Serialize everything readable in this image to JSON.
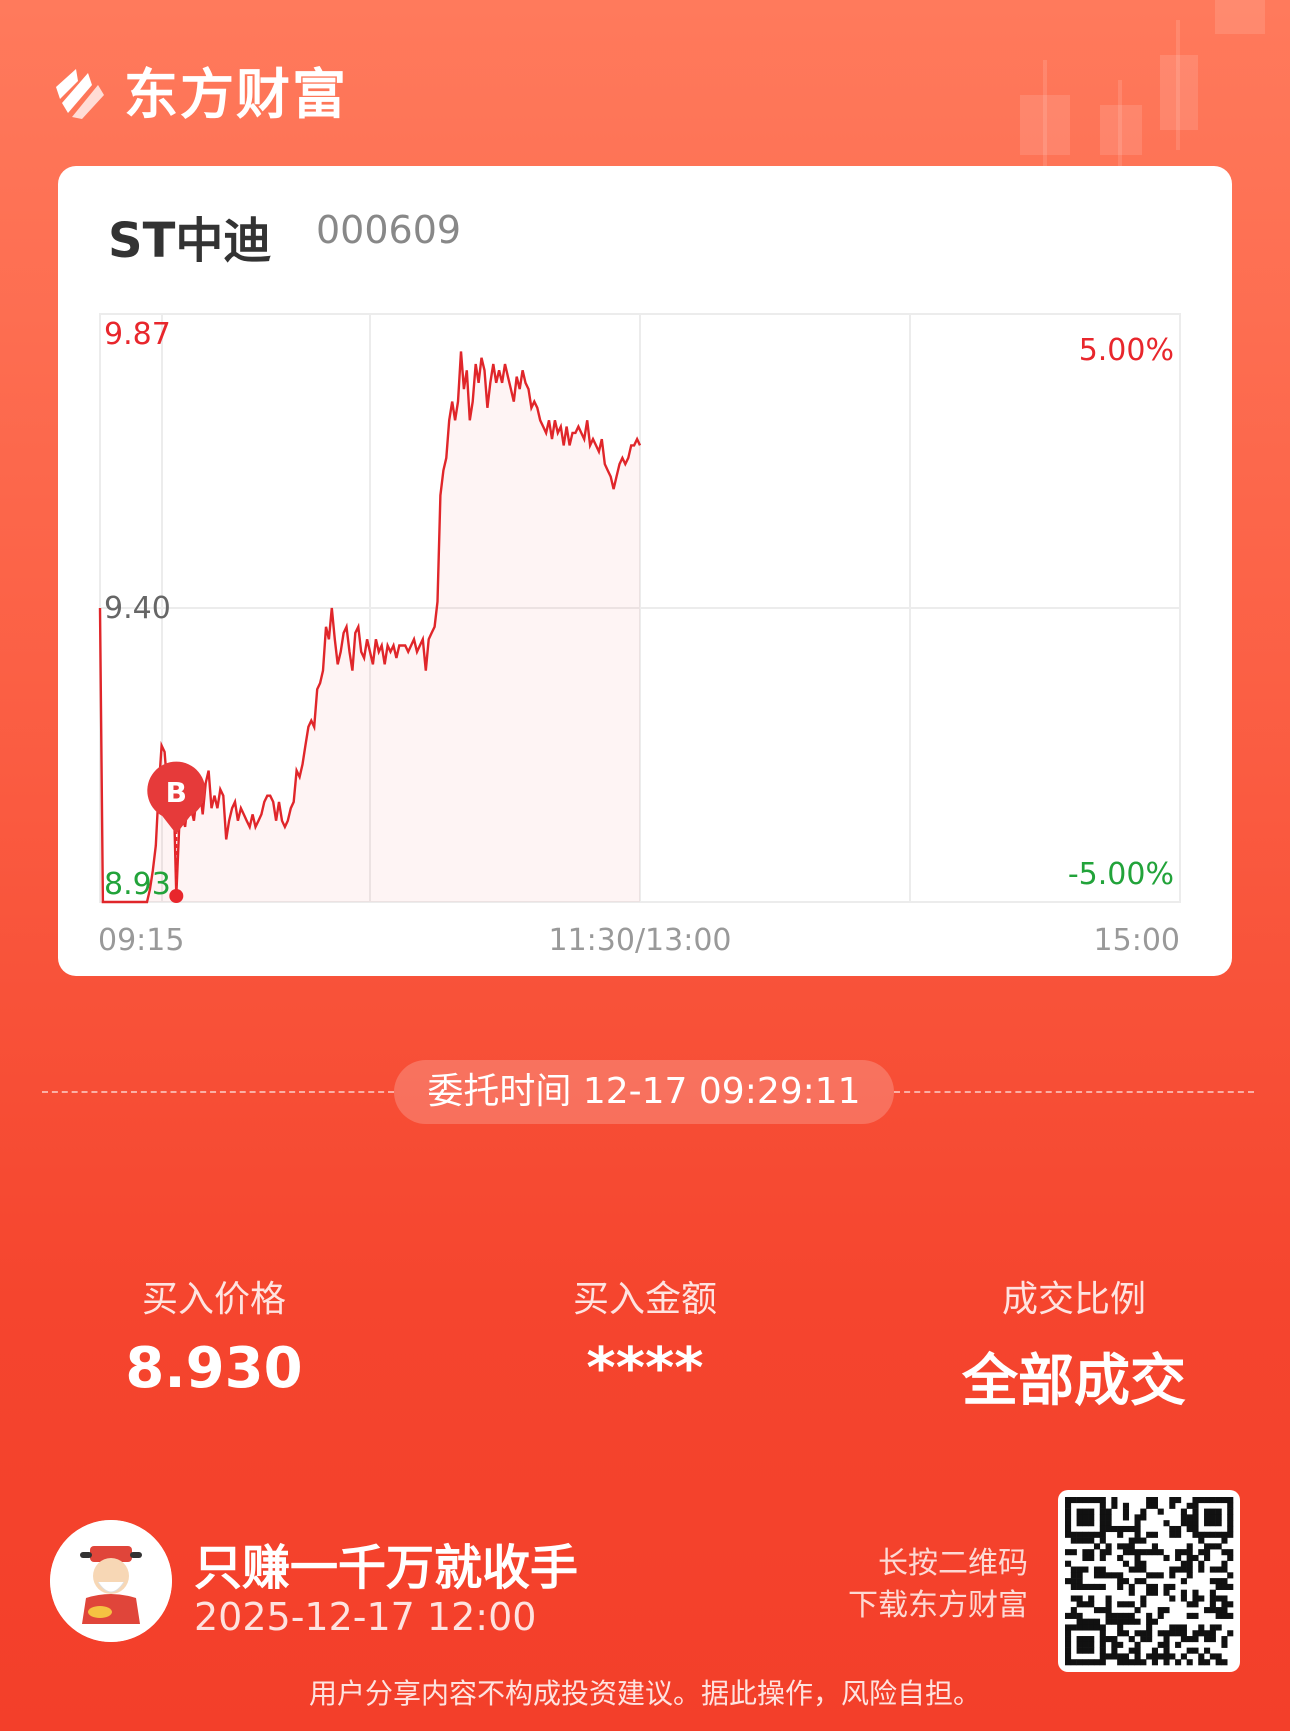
{
  "brand": {
    "name": "东方财富"
  },
  "stock": {
    "name": "ST中迪",
    "code": "000609"
  },
  "chart_data": {
    "type": "line",
    "y_labels": {
      "top": "9.87",
      "mid": "9.40",
      "bottom": "8.93"
    },
    "pct_labels": {
      "top": "5.00%",
      "bottom": "-5.00%"
    },
    "x_labels": [
      "09:15",
      "11:30/13:00",
      "15:00"
    ],
    "ylim": [
      8.93,
      9.87
    ],
    "marker": {
      "label": "B",
      "price": 8.93
    },
    "colors": {
      "up": "#e8262c",
      "down": "#22a33a",
      "line": "#e0262a",
      "mid": "#666666"
    },
    "series": [
      {
        "values": [
          9.4,
          8.93,
          8.93,
          8.93,
          8.93,
          8.93,
          8.93,
          8.93,
          8.93,
          8.93,
          8.93,
          8.93,
          8.93,
          8.93,
          8.93,
          8.93,
          8.93,
          8.95,
          8.98,
          9.02,
          9.11,
          9.18,
          9.17,
          9.11,
          9.13,
          9.12,
          8.94,
          9.05,
          9.07,
          9.05,
          9.09,
          9.08,
          9.06,
          9.1,
          9.11,
          9.07,
          9.12,
          9.14,
          9.08,
          9.1,
          9.08,
          9.11,
          9.1,
          9.03,
          9.06,
          9.08,
          9.09,
          9.06,
          9.08,
          9.07,
          9.06,
          9.05,
          9.07,
          9.05,
          9.06,
          9.07,
          9.09,
          9.1,
          9.1,
          9.09,
          9.06,
          9.09,
          9.06,
          9.05,
          9.06,
          9.08,
          9.09,
          9.14,
          9.13,
          9.15,
          9.18,
          9.21,
          9.22,
          9.21,
          9.27,
          9.28,
          9.3,
          9.37,
          9.35,
          9.4,
          9.35,
          9.31,
          9.33,
          9.36,
          9.37,
          9.33,
          9.3,
          9.36,
          9.37,
          9.33,
          9.32,
          9.35,
          9.33,
          9.31,
          9.35,
          9.33,
          9.34,
          9.31,
          9.34,
          9.33,
          9.34,
          9.32,
          9.34,
          9.34,
          9.34,
          9.33,
          9.34,
          9.35,
          9.33,
          9.34,
          9.35,
          9.3,
          9.35,
          9.36,
          9.37,
          9.41,
          9.58,
          9.62,
          9.64,
          9.7,
          9.73,
          9.7,
          9.73,
          9.81,
          9.75,
          9.78,
          9.7,
          9.73,
          9.79,
          9.76,
          9.8,
          9.78,
          9.72,
          9.76,
          9.79,
          9.76,
          9.78,
          9.76,
          9.79,
          9.77,
          9.75,
          9.73,
          9.77,
          9.75,
          9.78,
          9.76,
          9.75,
          9.72,
          9.73,
          9.72,
          9.7,
          9.69,
          9.68,
          9.7,
          9.67,
          9.7,
          9.68,
          9.69,
          9.66,
          9.69,
          9.66,
          9.68,
          9.68,
          9.69,
          9.68,
          9.67,
          9.7,
          9.66,
          9.67,
          9.66,
          9.65,
          9.67,
          9.63,
          9.62,
          9.61,
          9.59,
          9.61,
          9.63,
          9.64,
          9.63,
          9.64,
          9.66,
          9.66,
          9.67,
          9.66
        ]
      }
    ]
  },
  "order_time": "委托时间 12-17 09:29:11",
  "stats": [
    {
      "label": "买入价格",
      "value": "8.930"
    },
    {
      "label": "买入金额",
      "value": "****"
    },
    {
      "label": "成交比例",
      "value": "全部成交"
    }
  ],
  "user": {
    "title": "只赚一千万就收手",
    "date": "2025-12-17 12:00"
  },
  "qr_hint": {
    "line1": "长按二维码",
    "line2": "下载东方财富"
  },
  "disclaimer": "用户分享内容不构成投资建议。据此操作，风险自担。"
}
